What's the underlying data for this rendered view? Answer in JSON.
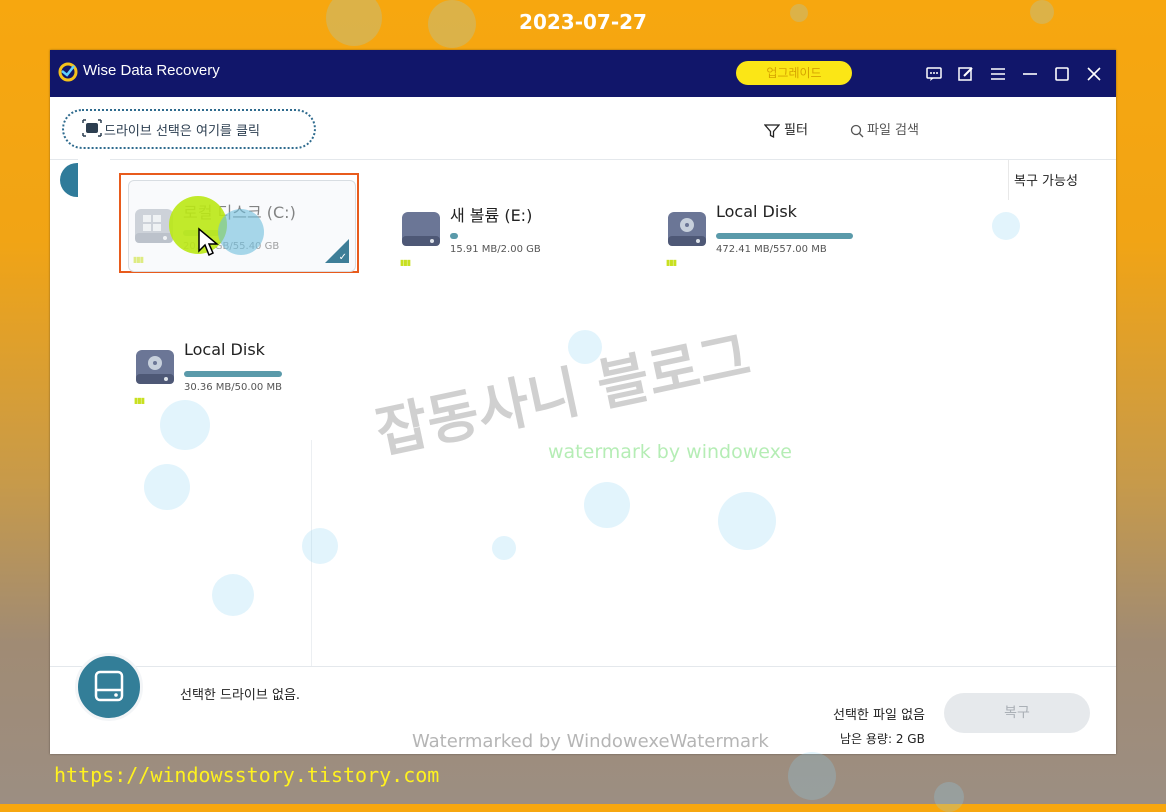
{
  "overlay": {
    "date": "2023-07-27",
    "url": "https://windowsstory.tistory.com",
    "watermark_kr": "잡동사니 블로그",
    "watermark_en": "watermark by windowexe",
    "watermark_bottom": "Watermarked by WindowexeWatermark"
  },
  "titlebar": {
    "app_title": "Wise Data Recovery",
    "upgrade_label": "업그레이드",
    "icons": [
      "feedback-icon",
      "edit-icon",
      "menu-icon",
      "minimize-icon",
      "maximize-icon",
      "close-icon"
    ]
  },
  "toolbar": {
    "drive_select_label": "드라이브 선택은 여기를 클릭",
    "filter_label": "필터",
    "search_placeholder": "파일 검색"
  },
  "panel": {
    "recoverable_label": "복구 가능성"
  },
  "drives": [
    {
      "name": "로컬 디스크 (C:)",
      "size": "20.63 GB/55.40 GB",
      "used_fraction": 0.37,
      "selected": true
    },
    {
      "name": "새 볼륨 (E:)",
      "size": "15.91 MB/2.00 GB",
      "used_fraction": 0.01,
      "selected": false
    },
    {
      "name": "Local Disk",
      "size": "472.41 MB/557.00 MB",
      "used_fraction": 0.85,
      "selected": false
    },
    {
      "name": "Local Disk",
      "size": "30.36 MB/50.00 MB",
      "used_fraction": 0.61,
      "selected": false
    }
  ],
  "footer": {
    "no_drive": "선택한 드라이브 없음.",
    "no_file": "선택한 파일 없음",
    "remaining_label": "남은 용량:",
    "remaining_value": "2 GB",
    "recover_label": "복구"
  },
  "colors": {
    "titlebar": "#11166a",
    "accent": "#337e98",
    "selection_border": "#e85b1c",
    "upgrade": "#fbe616"
  }
}
